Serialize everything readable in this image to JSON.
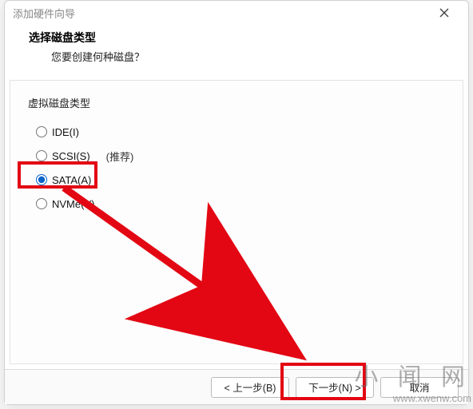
{
  "title": "添加硬件向导",
  "header": {
    "title": "选择磁盘类型",
    "subtitle": "您要创建何种磁盘？"
  },
  "section_title": "虚拟磁盘类型",
  "options": {
    "ide": {
      "label": "IDE(I)",
      "checked": false
    },
    "scsi": {
      "label": "SCSI(S)",
      "checked": false,
      "recommend": "(推荐)"
    },
    "sata": {
      "label": "SATA(A)",
      "checked": true
    },
    "nvme": {
      "label": "NVMe(V)",
      "checked": false
    }
  },
  "buttons": {
    "back": "< 上一步(B)",
    "next": "下一步(N) >",
    "cancel": "取消"
  },
  "watermark": {
    "line1": "小 闻 网",
    "line2": "www.xwenw.com"
  },
  "icons": {
    "close": "close-icon"
  }
}
